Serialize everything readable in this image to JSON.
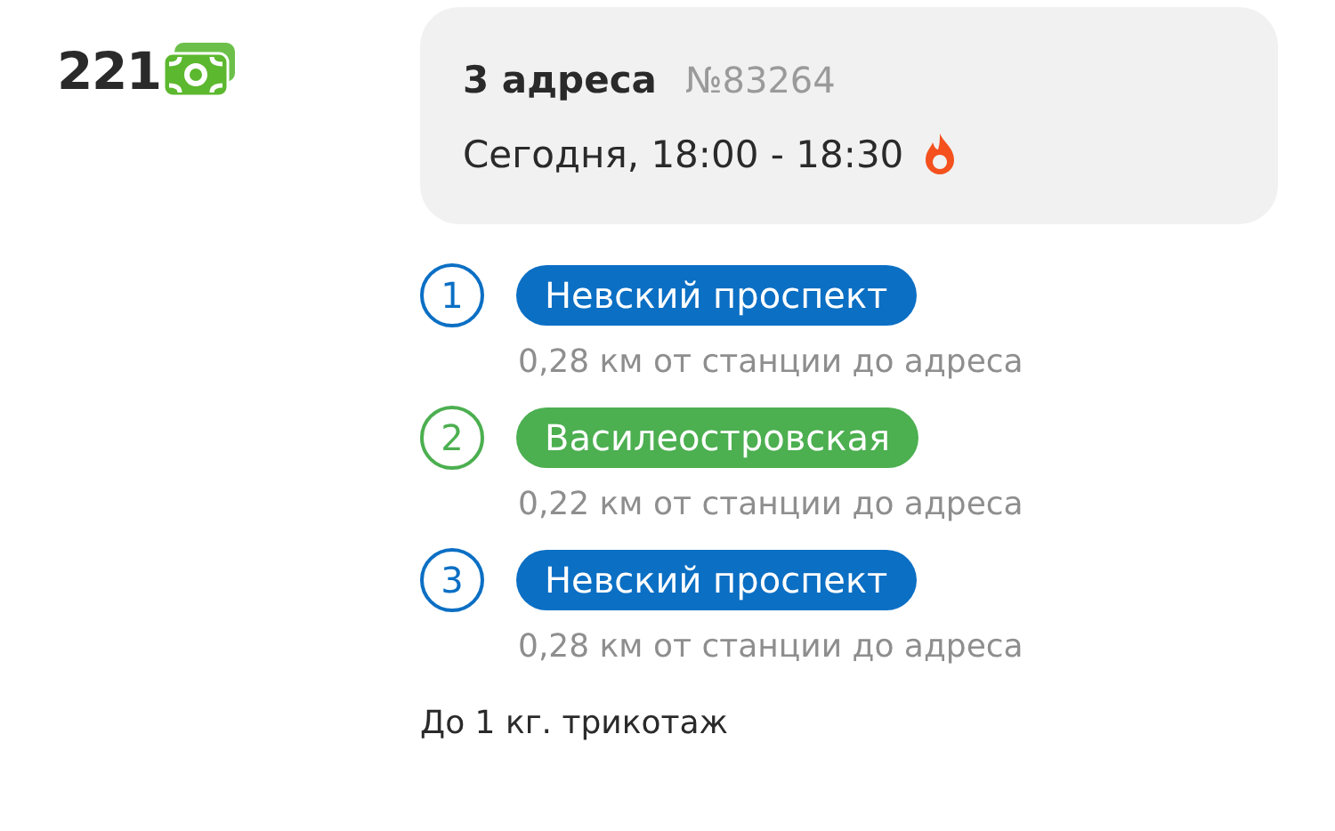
{
  "price": "221",
  "order": {
    "title": "3 адреса",
    "number": "№83264",
    "time": "Сегодня, 18:00 - 18:30",
    "urgent": true
  },
  "stops": [
    {
      "index": "1",
      "station": "Невский проспект",
      "color": "#0b6fc4",
      "distance": "0,28 км от станции до адреса"
    },
    {
      "index": "2",
      "station": "Василеостровская",
      "color": "#4caf50",
      "distance": "0,22 км от станции до адреса"
    },
    {
      "index": "3",
      "station": "Невский проспект",
      "color": "#0b6fc4",
      "distance": "0,28 км от станции до адреса"
    }
  ],
  "note": "До 1 кг. трикотаж"
}
